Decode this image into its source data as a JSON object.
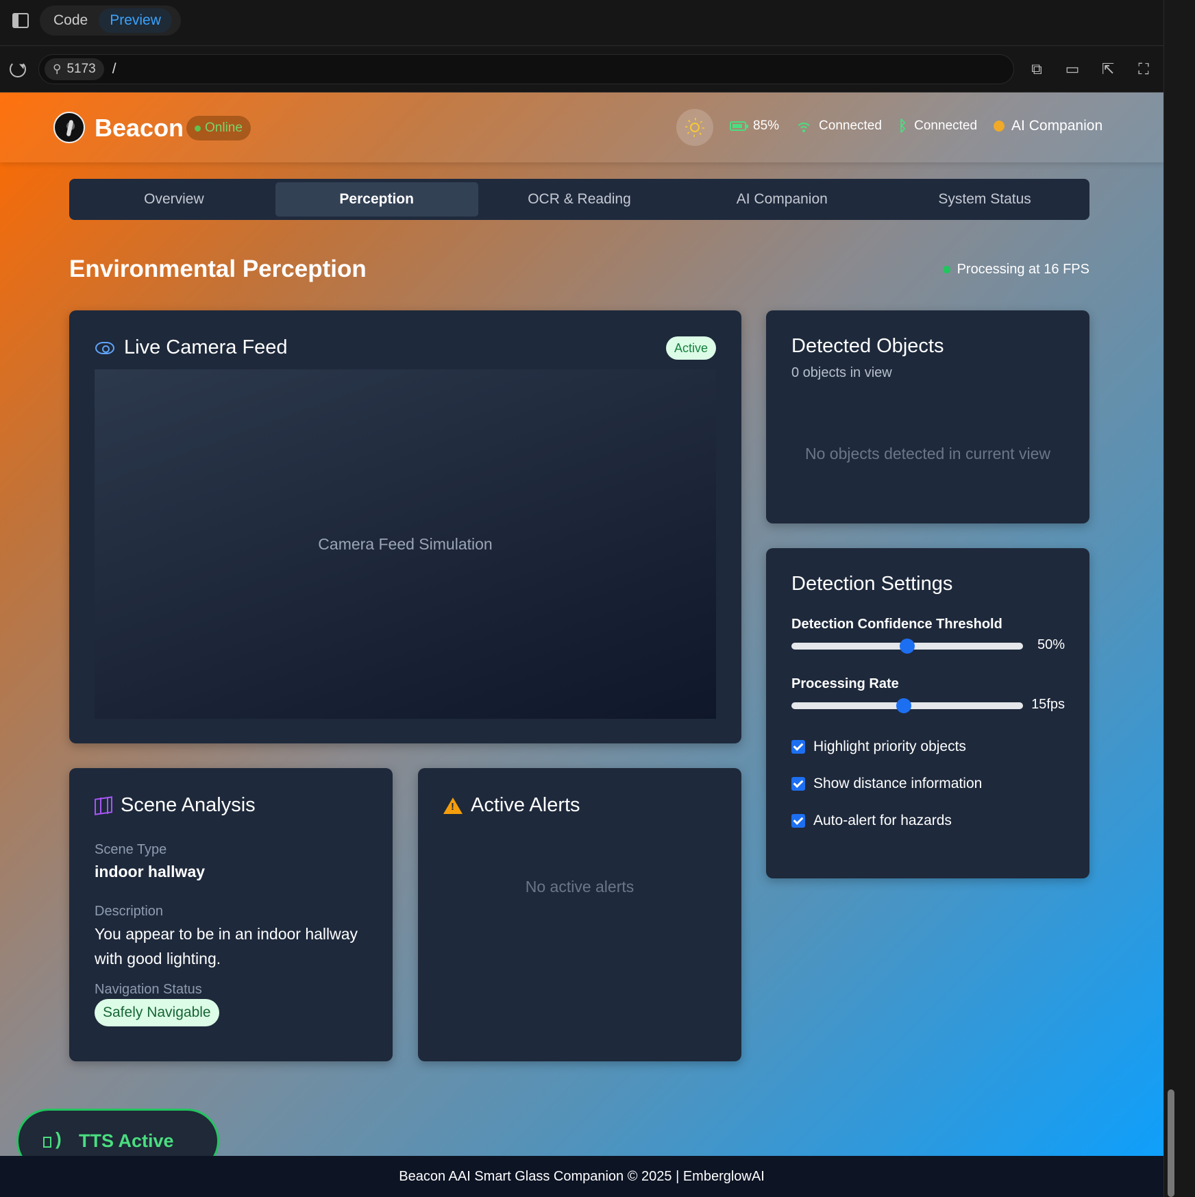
{
  "chrome": {
    "mode_tabs": [
      {
        "label": "Code",
        "active": false
      },
      {
        "label": "Preview",
        "active": true
      }
    ],
    "port": "5173",
    "path": "/",
    "actions": [
      "open-external-icon",
      "device-toggle-icon",
      "inspect-cursor-icon",
      "fullscreen-icon"
    ]
  },
  "header": {
    "brand": "Beacon",
    "online_label": "Online",
    "battery": "85%",
    "wifi": "Connected",
    "bluetooth": "Connected",
    "ai_label": "AI Companion",
    "colors": {
      "accent": "#4ade80",
      "ai_dot": "#f0a928",
      "sun": "#f7c933"
    }
  },
  "tabs": [
    {
      "label": "Overview",
      "active": false
    },
    {
      "label": "Perception",
      "active": true
    },
    {
      "label": "OCR & Reading",
      "active": false
    },
    {
      "label": "AI Companion",
      "active": false
    },
    {
      "label": "System Status",
      "active": false
    }
  ],
  "page": {
    "title": "Environmental Perception",
    "fps_status": "Processing at 16 FPS"
  },
  "camera": {
    "title": "Live Camera Feed",
    "badge": "Active",
    "placeholder": "Camera Feed Simulation"
  },
  "objects": {
    "title": "Detected Objects",
    "count": "0 objects in view",
    "empty": "No objects detected in current view"
  },
  "settings": {
    "title": "Detection Settings",
    "confidence": {
      "label": "Detection Confidence Threshold",
      "value": "50%",
      "fraction": 0.5
    },
    "rate": {
      "label": "Processing Rate",
      "value": "15fps",
      "fraction": 0.485
    },
    "checks": [
      {
        "label": "Highlight priority objects",
        "checked": true
      },
      {
        "label": "Show distance information",
        "checked": true
      },
      {
        "label": "Auto-alert for hazards",
        "checked": true
      }
    ]
  },
  "scene": {
    "title": "Scene Analysis",
    "type_label": "Scene Type",
    "type_value": "indoor hallway",
    "desc_label": "Description",
    "desc_value": "You appear to be in an indoor hallway with good lighting.",
    "nav_label": "Navigation Status",
    "nav_value": "Safely Navigable"
  },
  "alerts": {
    "title": "Active Alerts",
    "empty": "No active alerts"
  },
  "tts": {
    "label": "TTS Active"
  },
  "footer": {
    "text": "Beacon AAI Smart Glass Companion © 2025 | EmberglowAI"
  }
}
